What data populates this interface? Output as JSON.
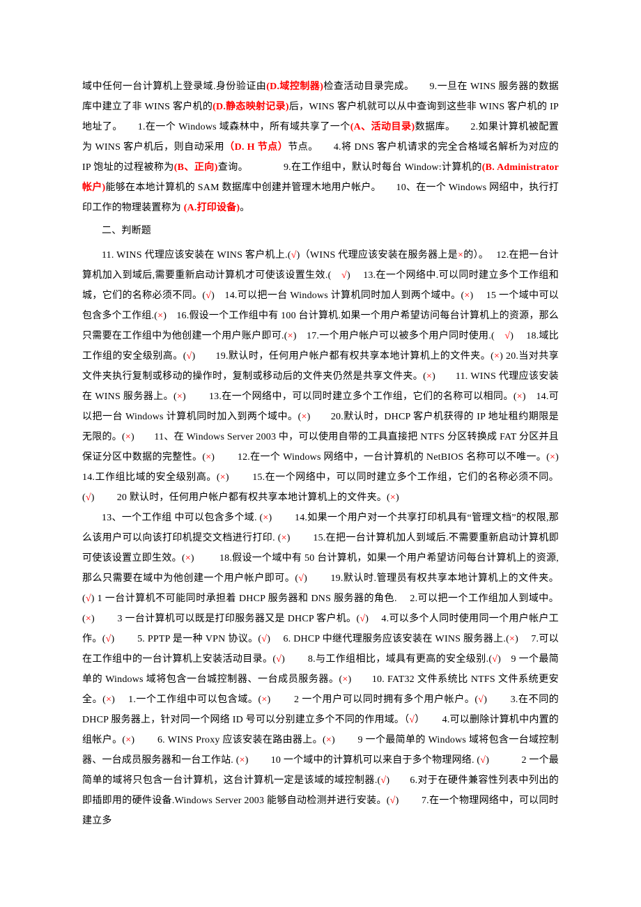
{
  "p1": {
    "t1a": "域中任何一台计算机上登录域.身份验证由",
    "t1b": "(D.域控制器)",
    "t1c": "检查活动目录完成。",
    "gap1": "　　",
    "t2a": "9.一旦在 WINS 服务器的数据库中建立了非 WINS 客户机的",
    "t2b": "(D.静态映射记录)",
    "t2c": "后，WINS 客户机就可以从中查询到这些非 WINS 客户机的 IP 地址了。",
    "gap2": "　　",
    "t3a": "1.在一个 Windows 域森林中，所有域共享了一个",
    "t3b": "(A、活动目录)",
    "t3c": "数据库。",
    "gap3": "　　",
    "t4a": "2.如果计算机被配置为 WINS 客户机后，则自动采用",
    "t4b": "（D. H 节点）",
    "t4c": "节点。",
    "gap4": "　　",
    "t5a": "4.将 DNS 客户机请求的完全合格域名解析为对应的 IP 饱址的过程被称为",
    "t5b": "(B、正向)",
    "t5c": "查询。",
    "gap5": "　　　　",
    "t6a": "9.在工作组中，默认时每台 Window:计算机的",
    "t6b": "(B. Administrator 帐户)",
    "t6c": "能够在本地计算机的 SAM 数据库中创建并管理木地用户帐户。",
    "gap6": "　　",
    "t7a": "10、在一个 Windows 网绍中，执行打印工作的物理装置称为 ",
    "t7b": "(A.打印设备)",
    "t7c": "。"
  },
  "heading2": "二、判断题",
  "p2": {
    "t1": "11. WINS 代理应该安装在 WINS 客户机上.(",
    "m1": "√",
    "t2": ")（WINS 代理应该安装在服务器上是",
    "m2": "×",
    "t3": "的）。　 12.在把一台计算机加入到域后,需要重新启动计算机才可使该设置生效.(　",
    "m3": "√",
    "t4": ")　 13.在一个网络中.可以同时建立多个工作组和城，它们的名称必须不同。(",
    "m4": "√",
    "t5": ")　14.可以把一台 Windows 计算机同时加人到两个域中。(",
    "m5": "×",
    "t6": ")　 15 一个域中可以包含多个工作组.(",
    "m6": "×",
    "t7": ")　16.假设一个工作组中有 100 台计算机.如果一个用户希望访问每台计算机上的资源，那么只需要在工作组中为他创建一个用户账户即可.(",
    "m7": "×",
    "t8": ")　17.一个用户帐户可以被多个用户同时使用.(　",
    "m8": "√",
    "t9": ")　 18.域比工作组的安全级别高。(",
    "m9": "√",
    "t10": ")　　19.默认时，任何用户帐户都有权共享本地计算机上的文件夹。(",
    "m10": "×",
    "t11": ") 20.当对共享文件夹执行复制或移动的操作时，复制或移动后的文件夹仍然是共享文件夹。(",
    "m11": "×",
    "t12": ")　　11. WINS 代理应该安装在 WINS 服务器上。(",
    "m12": "×",
    "t13": ")　　 13.在一个网络中，可以同时建立多个工作组，它们的名称可以相同。(",
    "m13": "×",
    "t14": ")　14.可以把一台 Windows 计算机同时加入到两个域中。(",
    "m14": "×",
    "t15": ")　　20.默认时，DHCP 客户机获得的 IP 地址租约期限是无限的。(",
    "m15": "×",
    "t16": ")　　11、在 Windows Server 2003 中，可以使用自带的工具直接把 NTFS 分区转换成 FAT 分区并且保证分区中数据的完整性。(",
    "m16": "×",
    "t17": ")　　 12.在一个 Windows 网络中，一台计算机的 NetBIOS 名称可以不唯一。(",
    "m17": "×",
    "t18": ")　　 14.工作组比域的安全级别高。(",
    "m18": "×",
    "t19": ")　　  15.在一个网络中，可以同时建立多个工作组，它们的名称必须不同。(",
    "m19": "√",
    "t20": ")　　 20 默认时，任何用户帐户都有权共享本地计算机上的文件夹。(",
    "m20": "×",
    "t21": ")"
  },
  "p3": {
    "t1": "13、一个工作组 中可以包含多个域. (",
    "m1": "×",
    "t2": ")　　  14.如果一个用户对一个共享打印机具有“管理文档”的权限,那么该用户可以向该打印机提交文档进行打印. (",
    "m2": "×",
    "t3": ")　　  15.在把一台计算机加人到域后.不需要重新启动计算机即可使该设置立即生效。(",
    "m3": "×",
    "t4": ") 　　 18.假设一个域中有 50 台计算机，如果一个用户希望访问每台计算机上的资源, 那么只需要在域中为他创建一个用户帐户即可。(",
    "m4": "√",
    "t5": ")　　 19.默认时.管理员有权共享本地计算机上的文件夹。(",
    "m5": "√",
    "t6": ") 1 一台计算机不可能同时承担着 DHCP 服务器和 DNS 服务器的角色.　 2.可以把一个工作组加人到域中。(",
    "m6": "×",
    "t7": ")　　 3 一台计算机可以既是打印服务器又是 DHCP 客户机。(",
    "m7": "√",
    "t8": ")　 4.可以多个人同时使用同一个用户帐户工作。(",
    "m8": "√",
    "t9": ")　　 5. PPTP 是一种 VPN 协议。(",
    "m9": "√",
    "t10": ")　 6. DHCP 中继代理服务应该安装在 WINS 服务器上.(",
    "m10": "×",
    "t11": ")　 7.可以在工作组中的一台计算机上安装活动目录。(",
    "m11": "√",
    "t12": ")　　 8.与工作组相比，域具有更高的安全级别.(",
    "m12": "√",
    "t13": ")　9 一个最简单的 Windows 域将包含一台城控制器、一台成员服务器。(",
    "m13": "×",
    "t14": ")　　10. FAT32 文件系统比 NTFS 文件系统更安全。(",
    "m14": "×",
    "t15": ")　 1.一个工作组中可以包含域。(",
    "m15": "×",
    "t16": ")　　 2 一个用户可以同时拥有多个用户帐户。(",
    "m16": "√",
    "t17": ")　　  3.在不同的 DHCP 服务器上，针对同一个网络 ID 号可以分别建立多个不同的作用域。（",
    "m17": "√",
    "t18": "）　　 4.可以删除计算机中内置的组帐户。(",
    "m18": "×",
    "t19": ")　　 6. WINS Proxy 应该安装在路由器上。(",
    "m19": "×",
    "t20": ")　　 9 一个最简单的 Windows 域将包含一台域控制器、一台成员服务器和一台工作站. (",
    "m20": "×",
    "t21": ")　　 10 一个域中的计算机可以来自于多个物理网络. (",
    "m21": "√",
    "t22": ")　　　 2 一个最简单的域将只包含一台计算机，这台计算机一定是该域的域控制器.(",
    "m22": "√",
    "t23": ")　　6.对于在硬件兼容性列表中列出的即插即用的硬件设备.Windows Server 2003 能够自动检测并进行安装。(",
    "m23": "√",
    "t24": ")　　 7.在一个物理网络中，可以同时建立多"
  }
}
